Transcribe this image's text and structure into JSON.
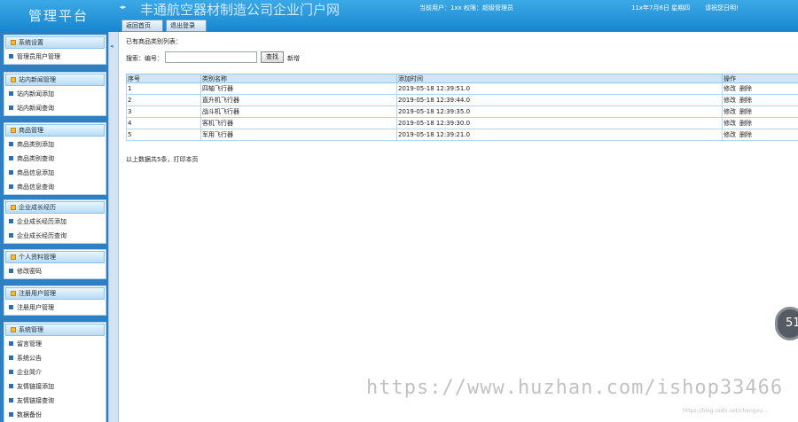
{
  "header": {
    "brand": "管理平台",
    "collapse_icon": "◂▸",
    "site_title": "丰通航空器材制造公司企业门户网",
    "user_info": "当前用户：1xx  权限：超级管理员",
    "date": "11x年7月6日 星期四",
    "welcome": "请祝您日明!",
    "home_btn": "返回首页",
    "logout_btn": "退出登录"
  },
  "sidebar": {
    "groups": [
      {
        "title": "系统设置",
        "items": [
          "管理员用户管理"
        ]
      },
      {
        "title": "站内新闻管理",
        "items": [
          "站内新闻添加",
          "站内新闻查询"
        ]
      },
      {
        "title": "商品管理",
        "items": [
          "商品类别添加",
          "商品类别查询",
          "商品信息添加",
          "商品信息查询"
        ]
      },
      {
        "title": "企业成长经历",
        "items": [
          "企业成长经历添加",
          "企业成长经历查询"
        ]
      },
      {
        "title": "个人资料管理",
        "items": [
          "修改密码"
        ]
      },
      {
        "title": "注册用户管理",
        "items": [
          "注册用户管理"
        ]
      },
      {
        "title": "系统管理",
        "items": [
          "留言管理",
          "系统公告",
          "企业简介",
          "友情链接添加",
          "友情链接查询",
          "数据备份"
        ]
      }
    ]
  },
  "main": {
    "list_title": "已有商品类别列表：",
    "search_label": "搜索：编号：",
    "search_placeholder": "",
    "search_btn": "查找",
    "add_link": "新增",
    "columns": [
      "序号",
      "类别名称",
      "添加时间",
      "操作"
    ],
    "rows": [
      {
        "id": "1",
        "name": "四轴飞行器",
        "time": "2019-05-18 12:39:51.0"
      },
      {
        "id": "2",
        "name": "直升机飞行器",
        "time": "2019-05-18 12:39:44.0"
      },
      {
        "id": "3",
        "name": "战斗机飞行器",
        "time": "2019-05-18 12:39:35.0"
      },
      {
        "id": "4",
        "name": "客机飞行器",
        "time": "2019-05-18 12:39:30.0"
      },
      {
        "id": "5",
        "name": "军用飞行器",
        "time": "2019-05-18 12:39:21.0"
      }
    ],
    "edit_label": "修改",
    "delete_label": "删除",
    "summary": "以上数据共5条，打印本页"
  },
  "overlay": {
    "badge": "51",
    "watermark": "https://www.huzhan.com/ishop33466",
    "watermark_small": "https://blog.csdn.net/chengxu..."
  }
}
